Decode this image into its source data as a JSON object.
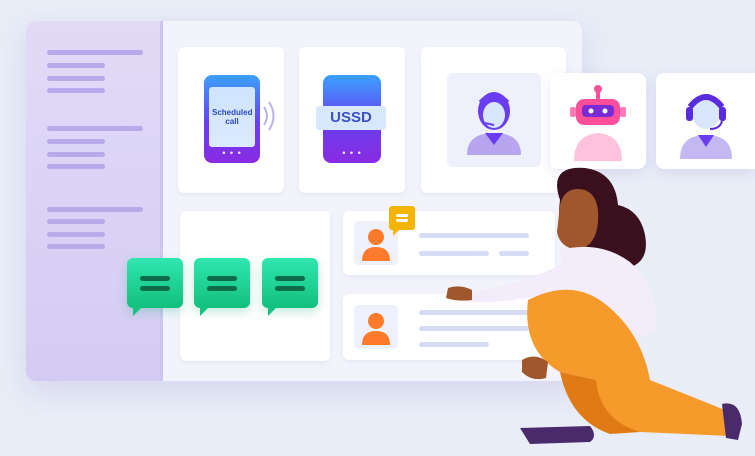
{
  "phone_scheduled": {
    "label": "Scheduled call",
    "icon": "phone-signal-icon"
  },
  "phone_ussd": {
    "label": "USSD",
    "icon": "ussd-phone-icon"
  },
  "agents": [
    {
      "icon": "support-agent-female-icon"
    },
    {
      "icon": "chatbot-robot-icon"
    },
    {
      "icon": "support-agent-headset-icon"
    }
  ],
  "chat_bubbles": [
    {
      "icon": "chat-bubble-icon"
    },
    {
      "icon": "chat-bubble-icon"
    },
    {
      "icon": "chat-bubble-icon"
    }
  ],
  "contacts": [
    {
      "icon": "user-avatar-icon",
      "has_message_badge": true
    },
    {
      "icon": "user-avatar-icon",
      "has_message_badge": false
    }
  ],
  "colors": {
    "background": "#e9edf7",
    "sidebar": "#d4cbf3",
    "phone_gradient_start": "#3aa0ff",
    "phone_gradient_end": "#8a2be2",
    "chat_green": "#12c07e",
    "avatar_orange": "#ff7a2a",
    "robot_pink": "#ff4f9a",
    "agent_purple": "#6a3ef0"
  }
}
